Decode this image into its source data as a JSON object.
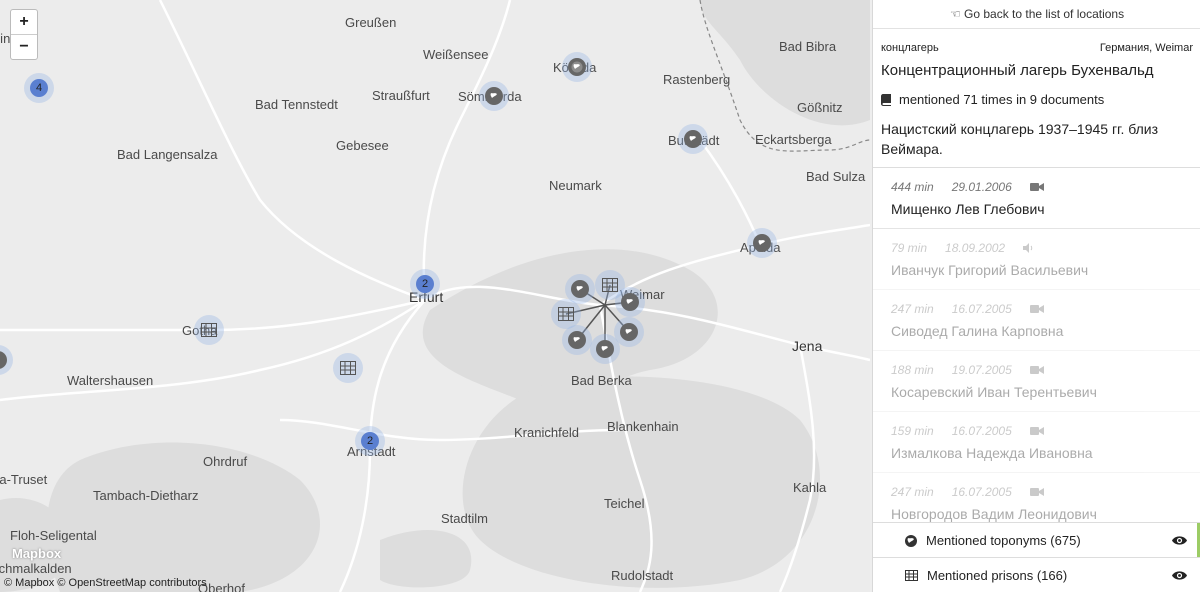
{
  "map": {
    "zoom_in": "+",
    "zoom_out": "−",
    "logo": "Mapbox",
    "attribution": "© Mapbox © OpenStreetMap contributors",
    "cities": [
      {
        "name": "Greußen",
        "big": false
      },
      {
        "name": "Weißensee",
        "big": false
      },
      {
        "name": "Kölleda",
        "big": false
      },
      {
        "name": "Bad Bibra",
        "big": false
      },
      {
        "name": "Rastenberg",
        "big": false
      },
      {
        "name": "Bad Tennstedt",
        "big": false
      },
      {
        "name": "Straußfurt",
        "big": false
      },
      {
        "name": "Sömmerda",
        "big": false
      },
      {
        "name": "Gößnitz",
        "big": false
      },
      {
        "name": "Gebesee",
        "big": false
      },
      {
        "name": "Buttstädt",
        "big": false
      },
      {
        "name": "Eckartsberga",
        "big": false
      },
      {
        "name": "Bad Langensalza",
        "big": false
      },
      {
        "name": "Bad Sulza",
        "big": false
      },
      {
        "name": "Neumark",
        "big": false
      },
      {
        "name": "Apolda",
        "big": false
      },
      {
        "name": "Erfurt",
        "big": true
      },
      {
        "name": "Weimar",
        "big": false
      },
      {
        "name": "Gotha",
        "big": false
      },
      {
        "name": "Jena",
        "big": true
      },
      {
        "name": "Waltershausen",
        "big": false
      },
      {
        "name": "Bad Berka",
        "big": false
      },
      {
        "name": "Kranichfeld",
        "big": false
      },
      {
        "name": "Blankenhain",
        "big": false
      },
      {
        "name": "Arnstadt",
        "big": false
      },
      {
        "name": "Ohrdruf",
        "big": false
      },
      {
        "name": "Friedrichroda-Truset",
        "big": false
      },
      {
        "name": "Kahla",
        "big": false
      },
      {
        "name": "Tambach-Dietharz",
        "big": false
      },
      {
        "name": "Teichel",
        "big": false
      },
      {
        "name": "Floh-Seligental",
        "big": false
      },
      {
        "name": "Stadtilm",
        "big": false
      },
      {
        "name": "Schmalkalden",
        "big": false
      },
      {
        "name": "Rudolstadt",
        "big": false
      },
      {
        "name": "Oberhof",
        "big": false
      },
      {
        "name": "Mühlhausen/Thüringen",
        "big": false
      }
    ],
    "clusters": [
      "4",
      "2",
      "2"
    ]
  },
  "panel": {
    "back_label": "Go back to the list of locations",
    "type": "концлагерь",
    "country": "Германия, Weimar",
    "title": "Концентрационный лагерь Бухенвальд",
    "mentions": "mentioned 71 times in 9 documents",
    "description": "Нацистский концлагерь 1937–1945 гг. близ Веймара.",
    "documents": [
      {
        "duration": "444 min",
        "date": "29.01.2006",
        "media": "video",
        "name": "Мищенко Лев Глебович"
      },
      {
        "duration": "79 min",
        "date": "18.09.2002",
        "media": "audio",
        "name": "Иванчук Григорий Васильевич"
      },
      {
        "duration": "247 min",
        "date": "16.07.2005",
        "media": "video",
        "name": "Сиводед Галина Карповна"
      },
      {
        "duration": "188 min",
        "date": "19.07.2005",
        "media": "video",
        "name": "Косаревский Иван Терентьевич"
      },
      {
        "duration": "159 min",
        "date": "16.07.2005",
        "media": "video",
        "name": "Измалкова Надежда Ивановна"
      },
      {
        "duration": "247 min",
        "date": "16.07.2005",
        "media": "video",
        "name": "Новгородов Вадим Леонидович"
      }
    ],
    "toggles": [
      {
        "label": "Mentioned toponyms (675)",
        "icon": "globe-icon"
      },
      {
        "label": "Mentioned prisons (166)",
        "icon": "table-icon"
      }
    ]
  },
  "colors": {
    "accent": "#9ccc65",
    "cluster": "#5a7fd0",
    "marker_halo": "#b4c8eb"
  }
}
